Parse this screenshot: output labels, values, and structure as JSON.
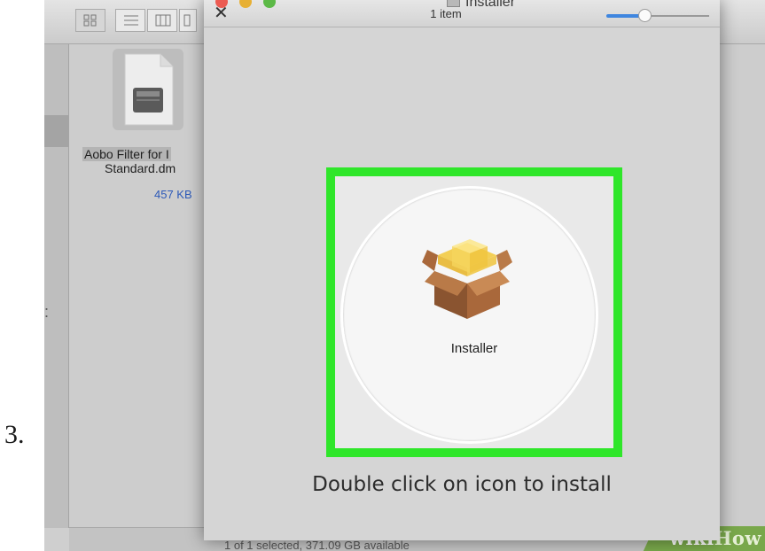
{
  "step_number": "3.",
  "finder": {
    "file": {
      "name_line1": "Aobo Filter for I",
      "name_line2": "Standard.dm",
      "size": "457 KB"
    },
    "status_text": "1 of 1 selected, 371.09 GB available",
    "watermark": {
      "wiki": "wiki",
      "how": "How"
    }
  },
  "dmg_window": {
    "title": "Installer",
    "item_count": "1 item",
    "icon_size_slider": {
      "value_fraction": 0.33
    },
    "package_label": "Installer",
    "instruction": "Double click on icon to install",
    "highlight_color": "#2fe62a"
  },
  "icons": [
    "grid-view-icon",
    "list-view-icon",
    "column-view-icon",
    "cover-flow-icon",
    "disk-image-icon",
    "close-icon",
    "installer-package-icon"
  ]
}
